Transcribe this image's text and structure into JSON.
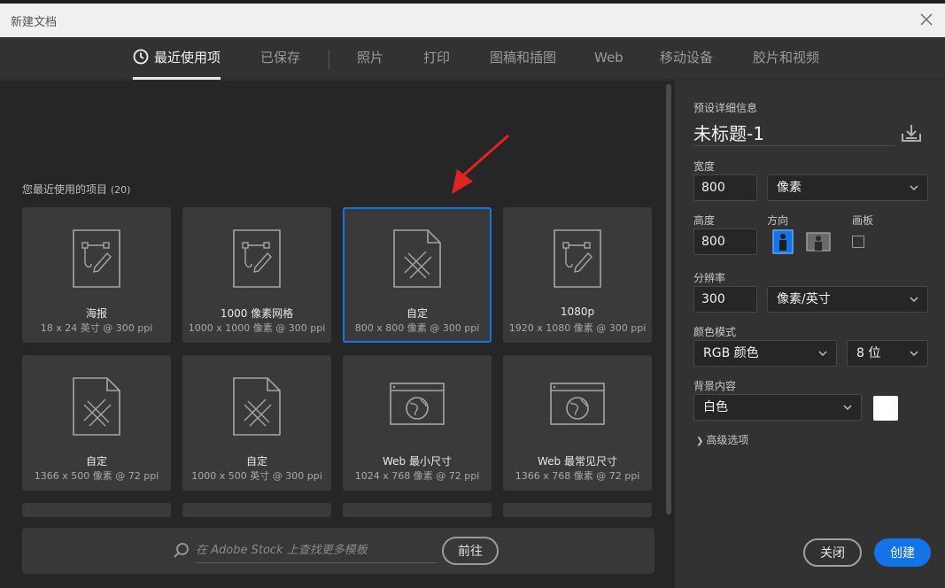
{
  "window": {
    "title": "新建文档"
  },
  "tabs": [
    {
      "label": "最近使用项"
    },
    {
      "label": "已保存"
    },
    {
      "label": "照片"
    },
    {
      "label": "打印"
    },
    {
      "label": "图稿和插图"
    },
    {
      "label": "Web"
    },
    {
      "label": "移动设备"
    },
    {
      "label": "胶片和视频"
    }
  ],
  "recent": {
    "label": "您最近使用的项目",
    "count": "(20)",
    "items": [
      {
        "name": "海报",
        "desc": "18 x 24 英寸 @ 300 ppi",
        "icon": "pen-tool-document-icon"
      },
      {
        "name": "1000 像素网格",
        "desc": "1000 x 1000 像素 @ 300 ppi",
        "icon": "pen-tool-document-icon"
      },
      {
        "name": "自定",
        "desc": "800 x 800 像素 @ 300 ppi",
        "icon": "pencil-ruler-document-icon"
      },
      {
        "name": "1080p",
        "desc": "1920 x 1080 像素 @ 300 ppi",
        "icon": "pen-tool-document-icon"
      },
      {
        "name": "自定",
        "desc": "1366 x 500 像素 @ 72 ppi",
        "icon": "pencil-ruler-document-icon"
      },
      {
        "name": "自定",
        "desc": "1000 x 500 英寸 @ 300 ppi",
        "icon": "pencil-ruler-document-icon"
      },
      {
        "name": "Web 最小尺寸",
        "desc": "1024 x 768 像素 @ 72 ppi",
        "icon": "web-globe-icon"
      },
      {
        "name": "Web 最常见尺寸",
        "desc": "1366 x 768 像素 @ 72 ppi",
        "icon": "web-globe-icon"
      }
    ]
  },
  "stock": {
    "placeholder": "在 Adobe Stock 上查找更多模板",
    "go_label": "前往"
  },
  "preset": {
    "section_label": "预设详细信息",
    "doc_name": "未标题-1",
    "width_label": "宽度",
    "width_value": "800",
    "width_unit": "像素",
    "height_label": "高度",
    "height_value": "800",
    "orientation_label": "方向",
    "artboard_label": "画板",
    "resolution_label": "分辨率",
    "resolution_value": "300",
    "resolution_unit": "像素/英寸",
    "color_mode_label": "颜色模式",
    "color_mode_value": "RGB 颜色",
    "bit_depth_value": "8 位",
    "background_label": "背景内容",
    "background_value": "白色",
    "advanced_label": "高级选项",
    "close_label": "关闭",
    "create_label": "创建"
  },
  "colors": {
    "accent": "#1473e6",
    "arrow": "#e02424",
    "background_swatch": "#ffffff"
  }
}
